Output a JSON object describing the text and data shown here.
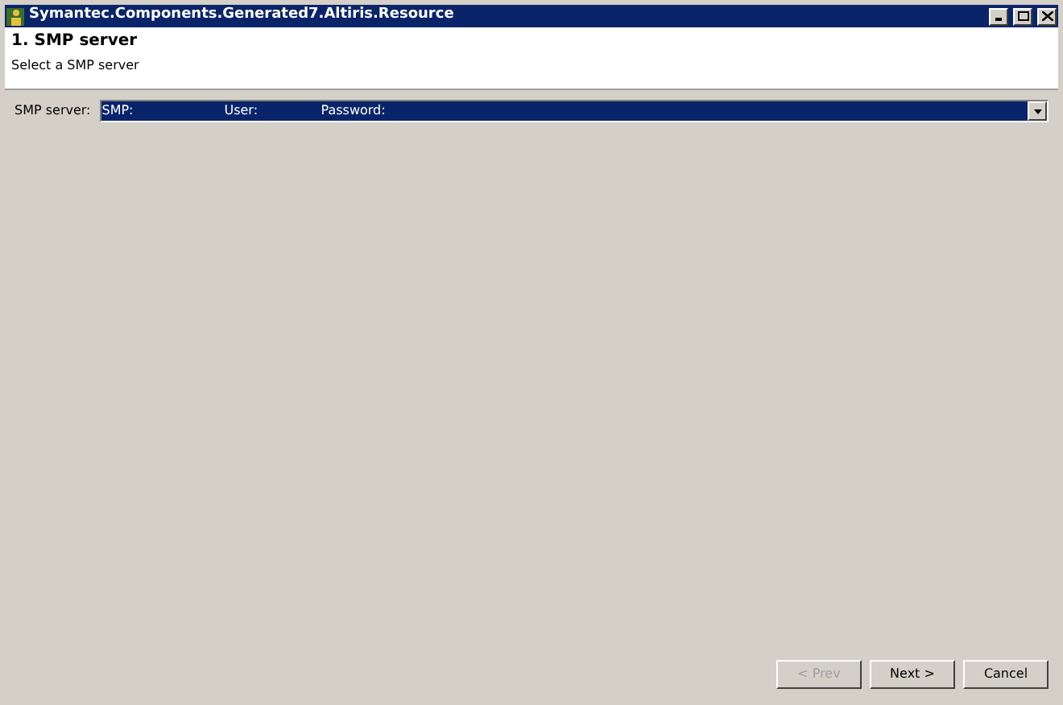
{
  "window": {
    "title": "Symantec.Components.Generated7.Altiris.Resource"
  },
  "header": {
    "title": "1. SMP server",
    "subtitle": "Select a SMP server"
  },
  "smp_field": {
    "label": "SMP server:",
    "highlighted": true,
    "columns": [
      "SMP:",
      "User:",
      "Password:"
    ]
  },
  "buttons": [
    {
      "label": "< Prev",
      "disabled": true
    },
    {
      "label": "Next >",
      "disabled": false
    },
    {
      "label": "Cancel",
      "disabled": false
    }
  ]
}
